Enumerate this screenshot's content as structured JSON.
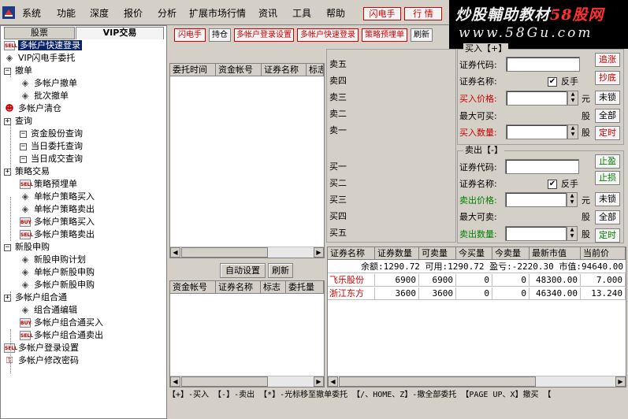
{
  "menubar": {
    "items": [
      "系统",
      "功能",
      "深度",
      "报价",
      "分析",
      "扩展市场行情",
      "资讯",
      "工具",
      "帮助"
    ],
    "flash_btn": "闪电手",
    "quote_btn": "行  情"
  },
  "brand": {
    "line1_a": "炒股輔助教材",
    "line1_b": "58股网",
    "line2": "www.58Gu.com"
  },
  "left": {
    "tabs": [
      "股票",
      "VIP交易"
    ],
    "tree": [
      {
        "label": "多帐户快速登录",
        "icon": "sell-badge-icon",
        "level": 0,
        "selected": true
      },
      {
        "label": "VIP闪电手委托",
        "icon": "diamond-icon",
        "level": 0
      },
      {
        "label": "撤单",
        "icon": "collapse-icon",
        "level": 0
      },
      {
        "label": "多帐户撤单",
        "icon": "diamond-icon",
        "level": 1
      },
      {
        "label": "批次撤单",
        "icon": "diamond-icon",
        "level": 1
      },
      {
        "label": "多帐户清仓",
        "icon": "person-icon",
        "level": 0
      },
      {
        "label": "查询",
        "icon": "expand-icon",
        "level": 0
      },
      {
        "label": "资金股份查询",
        "icon": "collapse-icon",
        "level": 1
      },
      {
        "label": "当日委托查询",
        "icon": "collapse-icon",
        "level": 1
      },
      {
        "label": "当日成交查询",
        "icon": "collapse-icon",
        "level": 1
      },
      {
        "label": "策略交易",
        "icon": "expand-icon",
        "level": 0
      },
      {
        "label": "策略预埋单",
        "icon": "sell-badge-icon",
        "level": 1
      },
      {
        "label": "单帐户策略买入",
        "icon": "diamond-icon",
        "level": 1
      },
      {
        "label": "单帐户策略卖出",
        "icon": "diamond-icon",
        "level": 1
      },
      {
        "label": "多帐户策略买入",
        "icon": "buy-badge-icon",
        "level": 1
      },
      {
        "label": "多帐户策略卖出",
        "icon": "sell-badge-icon",
        "level": 1
      },
      {
        "label": "新股申购",
        "icon": "collapse-icon",
        "level": 0
      },
      {
        "label": "新股申购计划",
        "icon": "diamond-icon",
        "level": 1
      },
      {
        "label": "单帐户新股申购",
        "icon": "diamond-icon",
        "level": 1
      },
      {
        "label": "多帐户新股申购",
        "icon": "diamond-icon",
        "level": 1
      },
      {
        "label": "多帐户组合通",
        "icon": "expand-icon",
        "level": 0
      },
      {
        "label": "组合通编辑",
        "icon": "diamond-icon",
        "level": 1
      },
      {
        "label": "多帐户组合通买入",
        "icon": "buy-badge-icon",
        "level": 1
      },
      {
        "label": "多帐户组合通卖出",
        "icon": "sell-badge-icon",
        "level": 1
      },
      {
        "label": "多帐户登录设置",
        "icon": "sell-badge-icon",
        "level": 0
      },
      {
        "label": "多帐户修改密码",
        "icon": "key-icon",
        "level": 0
      }
    ]
  },
  "toolbar": [
    "闪电手",
    "持仓",
    "多帐户登录设置",
    "多帐户快速登录",
    "策略预埋单",
    "刷新"
  ],
  "orders_grid": {
    "headers": [
      "委托时间",
      "资金帐号",
      "证券名称",
      "标志"
    ]
  },
  "mid_buttons": {
    "auto_set": "自动设置",
    "refresh": "刷新"
  },
  "accounts_grid": {
    "headers": [
      "资金帐号",
      "证券名称",
      "标志",
      "委托量"
    ]
  },
  "order_book": {
    "sells": [
      "卖五",
      "卖四",
      "卖三",
      "卖二",
      "卖一"
    ],
    "buys": [
      "买一",
      "买二",
      "买三",
      "买四",
      "买五"
    ]
  },
  "buy_form": {
    "title": "买入【+】",
    "code_label": "证券代码:",
    "name_label": "证券名称:",
    "reverse_label": "反手",
    "reverse_checked": true,
    "price_label": "买入价格:",
    "unit_yuan": "元",
    "max_label": "最大可买:",
    "unit_gu": "股",
    "qty_label": "买入数量:",
    "btn_chase": "追涨",
    "btn_dip": "抄底",
    "btn_unlock": "未锁",
    "btn_all": "全部",
    "btn_timed": "定时"
  },
  "sell_form": {
    "title": "卖出【-】",
    "code_label": "证券代码:",
    "name_label": "证券名称:",
    "reverse_label": "反手",
    "reverse_checked": true,
    "price_label": "卖出价格:",
    "unit_yuan": "元",
    "max_label": "最大可卖:",
    "unit_gu": "股",
    "qty_label": "卖出数量:",
    "btn_profit": "止盈",
    "btn_loss": "止损",
    "btn_unlock": "未锁",
    "btn_all": "全部",
    "btn_timed": "定时"
  },
  "holdings": {
    "headers": [
      "证券名称",
      "证券数量",
      "可卖量",
      "今买量",
      "今卖量",
      "最新市值",
      "当前价"
    ],
    "summary": "余额:1290.72 可用:1290.72 盈亏:-2220.30 市值:94640.00",
    "rows": [
      [
        "飞乐股份",
        "6900",
        "6900",
        "0",
        "0",
        "48300.00",
        "7.000"
      ],
      [
        "浙江东方",
        "3600",
        "3600",
        "0",
        "0",
        "46340.00",
        "13.240"
      ]
    ]
  },
  "statusbar": "【+】-买入 【-】-卖出 【*】-光标移至撤单委托 【/、HOME、Z】-撤全部委托 【PAGE UP、X】撤买 【"
}
